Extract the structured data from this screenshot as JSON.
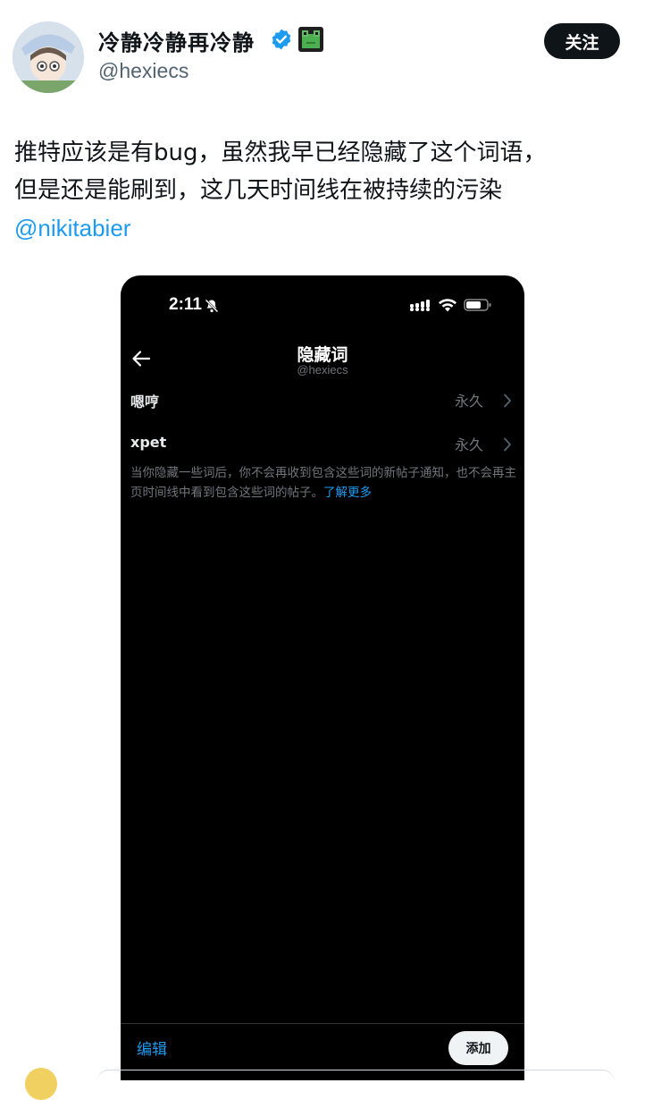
{
  "tweet": {
    "author_name": "冷静冷静再冷静",
    "author_handle": "@hexiecs",
    "follow_label": "关注",
    "line1": "推特应该是有bug，虽然我早已经隐藏了这个词语，",
    "line2": "但是还是能刷到，这几天时间线在被持续的污染",
    "mention": "@nikitabier",
    "verified_color": "#1d9bf0",
    "author_emoji": "frog-icon"
  },
  "screenshot": {
    "status_time": "2:11",
    "header_title": "隐藏词",
    "header_sub": "@hexiecs",
    "muted_words": [
      {
        "word": "嗯哼",
        "duration": "永久"
      },
      {
        "word": "xpet",
        "duration": "永久"
      }
    ],
    "description": "当你隐藏一些词后，你不会再收到包含这些词的新帖子通知，也不会再主页时间线中看到包含这些词的帖子。",
    "learn_more": "了解更多",
    "edit_label": "编辑",
    "add_label": "添加",
    "accent": "#1d9bf0",
    "background": "#000000"
  }
}
